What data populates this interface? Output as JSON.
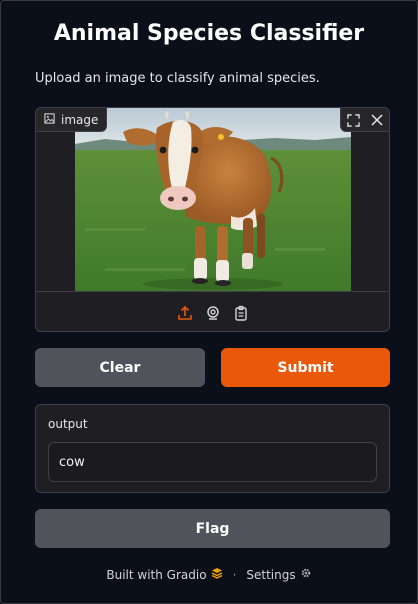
{
  "page": {
    "title": "Animal Species Classifier",
    "description": "Upload an image to classify animal species."
  },
  "image_input": {
    "label": "image",
    "label_icon": "image-icon",
    "tools": [
      "fullscreen-icon",
      "close-icon"
    ],
    "sources": [
      "upload-icon",
      "webcam-icon",
      "clipboard-icon"
    ],
    "photo_subject": "cow",
    "accent": "#ea580c"
  },
  "actions": {
    "clear_label": "Clear",
    "submit_label": "Submit",
    "flag_label": "Flag"
  },
  "output": {
    "label": "output",
    "value": "cow"
  },
  "footer": {
    "built_with": "Built with Gradio",
    "separator": "·",
    "settings": "Settings"
  },
  "colors": {
    "background": "#0b0f19",
    "panel": "#1f1f23",
    "secondary_button": "#52525b",
    "primary_button": "#ea580c"
  }
}
